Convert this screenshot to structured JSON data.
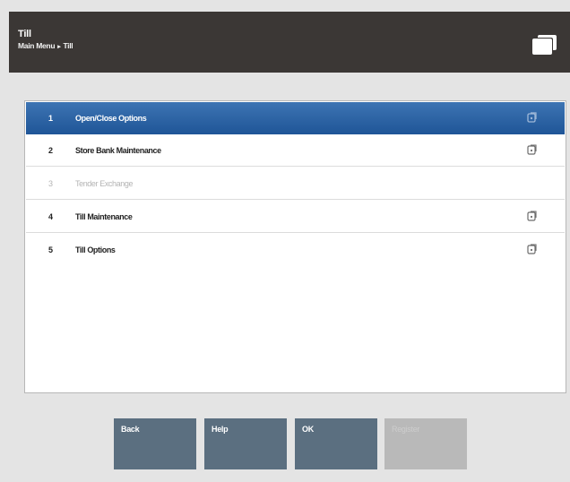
{
  "header": {
    "title": "Till",
    "breadcrumb": {
      "parent": "Main Menu",
      "separator": "▸",
      "current": "Till"
    },
    "icon": "window-stack-icon"
  },
  "menu": {
    "items": [
      {
        "number": "1",
        "label": "Open/Close Options",
        "state": "selected",
        "icon": "submenu-icon"
      },
      {
        "number": "2",
        "label": "Store Bank Maintenance",
        "state": "enabled",
        "icon": "submenu-icon"
      },
      {
        "number": "3",
        "label": "Tender Exchange",
        "state": "disabled",
        "icon": ""
      },
      {
        "number": "4",
        "label": "Till Maintenance",
        "state": "enabled",
        "icon": "submenu-icon"
      },
      {
        "number": "5",
        "label": "Till Options",
        "state": "enabled",
        "icon": "submenu-icon"
      }
    ]
  },
  "buttons": {
    "back": "Back",
    "help": "Help",
    "ok": "OK",
    "register": "Register"
  },
  "colors": {
    "header_bg": "#3b3735",
    "selected_row": "#2a63a5",
    "button_bg": "#5b6f80",
    "button_disabled_bg": "#b9b9b9",
    "page_bg": "#e4e4e4"
  }
}
